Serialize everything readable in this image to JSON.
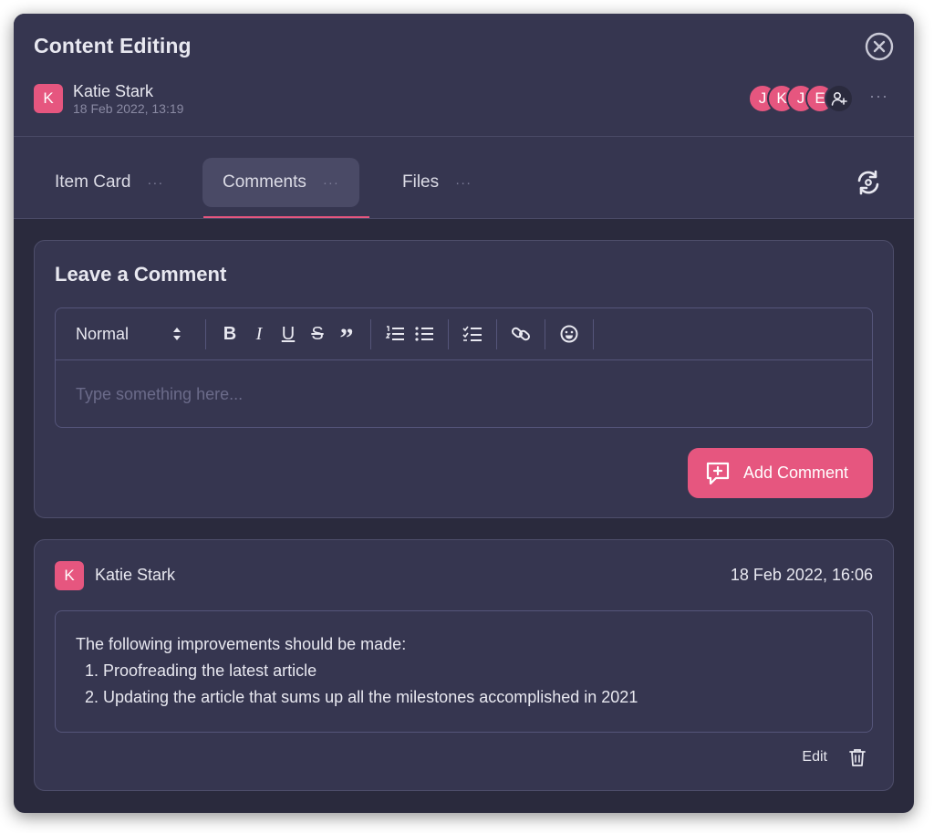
{
  "window": {
    "title": "Content Editing"
  },
  "header": {
    "author": {
      "initial": "K",
      "name": "Katie Stark",
      "date": "18 Feb 2022, 13:19"
    },
    "members": [
      "J",
      "K",
      "J",
      "E"
    ],
    "more": "···"
  },
  "tabs": [
    {
      "label": "Item Card",
      "dots": "···"
    },
    {
      "label": "Comments",
      "dots": "···",
      "active": true
    },
    {
      "label": "Files",
      "dots": "···"
    }
  ],
  "compose": {
    "title": "Leave a Comment",
    "format": "Normal",
    "toolbar_text": {
      "bold": "B",
      "italic": "I",
      "underline": "U",
      "strike": "S",
      "quote": "”"
    },
    "placeholder": "Type something here...",
    "add_label": "Add Comment"
  },
  "comment": {
    "initial": "K",
    "author": "Katie Stark",
    "date": "18 Feb 2022, 16:06",
    "intro": "The following improvements should be made:",
    "items": [
      "Proofreading the latest article",
      "Updating the article that sums up all the milestones accomplished in 2021"
    ],
    "edit_label": "Edit"
  },
  "colors": {
    "accent": "#e6567f",
    "background": "#2a2a3d",
    "panel": "#363650",
    "border": "#4e4e6b"
  }
}
